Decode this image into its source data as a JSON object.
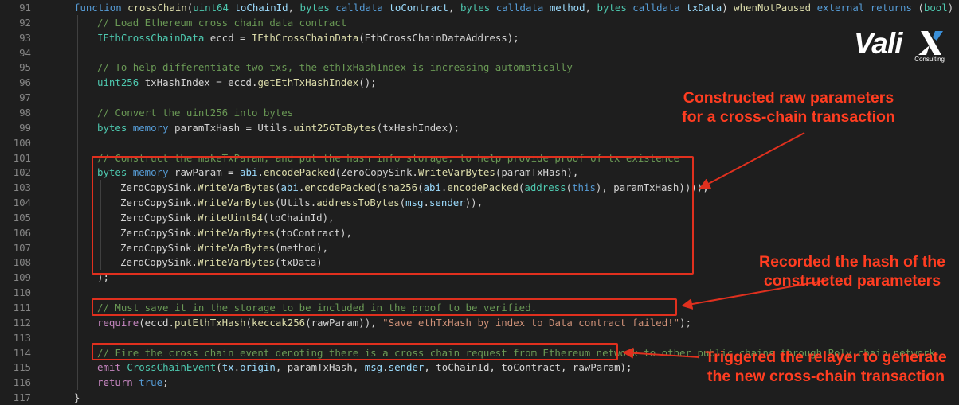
{
  "editor": {
    "lines": [
      {
        "n": "91",
        "indent": 1,
        "tokens": [
          [
            "kw",
            "function "
          ],
          [
            "fn",
            "crossChain"
          ],
          [
            "df",
            "("
          ],
          [
            "ty",
            "uint64 "
          ],
          [
            "pa",
            "toChainId"
          ],
          [
            "df",
            ", "
          ],
          [
            "ty",
            "bytes "
          ],
          [
            "kw",
            "calldata "
          ],
          [
            "pa",
            "toContract"
          ],
          [
            "df",
            ", "
          ],
          [
            "ty",
            "bytes "
          ],
          [
            "kw",
            "calldata "
          ],
          [
            "pa",
            "method"
          ],
          [
            "df",
            ", "
          ],
          [
            "ty",
            "bytes "
          ],
          [
            "kw",
            "calldata "
          ],
          [
            "pa",
            "txData"
          ],
          [
            "df",
            ") "
          ],
          [
            "fn",
            "whenNotPaused "
          ],
          [
            "kw",
            "external returns "
          ],
          [
            "df",
            "("
          ],
          [
            "ty",
            "bool"
          ],
          [
            "df",
            ") {"
          ]
        ]
      },
      {
        "n": "92",
        "indent": 2,
        "tokens": [
          [
            "cm",
            "// Load Ethereum cross chain data contract"
          ]
        ]
      },
      {
        "n": "93",
        "indent": 2,
        "tokens": [
          [
            "ty",
            "IEthCrossChainData "
          ],
          [
            "df",
            "eccd = "
          ],
          [
            "fn",
            "IEthCrossChainData"
          ],
          [
            "df",
            "(EthCrossChainDataAddress);"
          ]
        ]
      },
      {
        "n": "94",
        "indent": 2,
        "tokens": []
      },
      {
        "n": "95",
        "indent": 2,
        "tokens": [
          [
            "cm",
            "// To help differentiate two txs, the ethTxHashIndex is increasing automatically"
          ]
        ]
      },
      {
        "n": "96",
        "indent": 2,
        "tokens": [
          [
            "ty",
            "uint256 "
          ],
          [
            "df",
            "txHashIndex = eccd."
          ],
          [
            "fn",
            "getEthTxHashIndex"
          ],
          [
            "df",
            "();"
          ]
        ]
      },
      {
        "n": "97",
        "indent": 2,
        "tokens": []
      },
      {
        "n": "98",
        "indent": 2,
        "tokens": [
          [
            "cm",
            "// Convert the uint256 into bytes"
          ]
        ]
      },
      {
        "n": "99",
        "indent": 2,
        "tokens": [
          [
            "ty",
            "bytes "
          ],
          [
            "kw",
            "memory "
          ],
          [
            "df",
            "paramTxHash = Utils."
          ],
          [
            "fn",
            "uint256ToBytes"
          ],
          [
            "df",
            "(txHashIndex);"
          ]
        ]
      },
      {
        "n": "100",
        "indent": 2,
        "tokens": []
      },
      {
        "n": "101",
        "indent": 2,
        "tokens": [
          [
            "cm",
            "// Construct the makeTxParam, and put the hash info storage, to help provide proof of tx existence"
          ]
        ]
      },
      {
        "n": "102",
        "indent": 2,
        "tokens": [
          [
            "ty",
            "bytes "
          ],
          [
            "kw",
            "memory "
          ],
          [
            "df",
            "rawParam = "
          ],
          [
            "pa",
            "abi"
          ],
          [
            "df",
            "."
          ],
          [
            "fn",
            "encodePacked"
          ],
          [
            "df",
            "(ZeroCopySink."
          ],
          [
            "fn",
            "WriteVarBytes"
          ],
          [
            "df",
            "(paramTxHash),"
          ]
        ]
      },
      {
        "n": "103",
        "indent": 3,
        "tokens": [
          [
            "df",
            "ZeroCopySink."
          ],
          [
            "fn",
            "WriteVarBytes"
          ],
          [
            "df",
            "("
          ],
          [
            "pa",
            "abi"
          ],
          [
            "df",
            "."
          ],
          [
            "fn",
            "encodePacked"
          ],
          [
            "df",
            "("
          ],
          [
            "fn",
            "sha256"
          ],
          [
            "df",
            "("
          ],
          [
            "pa",
            "abi"
          ],
          [
            "df",
            "."
          ],
          [
            "fn",
            "encodePacked"
          ],
          [
            "df",
            "("
          ],
          [
            "ty",
            "address"
          ],
          [
            "df",
            "("
          ],
          [
            "kw",
            "this"
          ],
          [
            "df",
            "), paramTxHash)))),"
          ]
        ]
      },
      {
        "n": "104",
        "indent": 3,
        "tokens": [
          [
            "df",
            "ZeroCopySink."
          ],
          [
            "fn",
            "WriteVarBytes"
          ],
          [
            "df",
            "(Utils."
          ],
          [
            "fn",
            "addressToBytes"
          ],
          [
            "df",
            "("
          ],
          [
            "pa",
            "msg"
          ],
          [
            "df",
            "."
          ],
          [
            "pa",
            "sender"
          ],
          [
            "df",
            ")),"
          ]
        ]
      },
      {
        "n": "105",
        "indent": 3,
        "tokens": [
          [
            "df",
            "ZeroCopySink."
          ],
          [
            "fn",
            "WriteUint64"
          ],
          [
            "df",
            "(toChainId),"
          ]
        ]
      },
      {
        "n": "106",
        "indent": 3,
        "tokens": [
          [
            "df",
            "ZeroCopySink."
          ],
          [
            "fn",
            "WriteVarBytes"
          ],
          [
            "df",
            "(toContract),"
          ]
        ]
      },
      {
        "n": "107",
        "indent": 3,
        "tokens": [
          [
            "df",
            "ZeroCopySink."
          ],
          [
            "fn",
            "WriteVarBytes"
          ],
          [
            "df",
            "(method),"
          ]
        ]
      },
      {
        "n": "108",
        "indent": 3,
        "tokens": [
          [
            "df",
            "ZeroCopySink."
          ],
          [
            "fn",
            "WriteVarBytes"
          ],
          [
            "df",
            "(txData)"
          ]
        ]
      },
      {
        "n": "109",
        "indent": 2,
        "tokens": [
          [
            "df",
            ");"
          ]
        ]
      },
      {
        "n": "110",
        "indent": 2,
        "tokens": []
      },
      {
        "n": "111",
        "indent": 2,
        "tokens": [
          [
            "cm",
            "// Must save it in the storage to be included in the proof to be verified."
          ]
        ]
      },
      {
        "n": "112",
        "indent": 2,
        "tokens": [
          [
            "ct",
            "require"
          ],
          [
            "df",
            "(eccd."
          ],
          [
            "fn",
            "putEthTxHash"
          ],
          [
            "df",
            "("
          ],
          [
            "fn",
            "keccak256"
          ],
          [
            "df",
            "(rawParam)), "
          ],
          [
            "st",
            "\"Save ethTxHash by index to Data contract failed!\""
          ],
          [
            "df",
            ");"
          ]
        ]
      },
      {
        "n": "113",
        "indent": 2,
        "tokens": []
      },
      {
        "n": "114",
        "indent": 2,
        "tokens": [
          [
            "cm",
            "// Fire the cross chain event denoting there is a cross chain request from Ethereum network to other public chains through Poly chain network"
          ]
        ]
      },
      {
        "n": "115",
        "indent": 2,
        "tokens": [
          [
            "ct",
            "emit "
          ],
          [
            "ty",
            "CrossChainEvent"
          ],
          [
            "df",
            "("
          ],
          [
            "pa",
            "tx"
          ],
          [
            "df",
            "."
          ],
          [
            "pa",
            "origin"
          ],
          [
            "df",
            ", paramTxHash, "
          ],
          [
            "pa",
            "msg"
          ],
          [
            "df",
            "."
          ],
          [
            "pa",
            "sender"
          ],
          [
            "df",
            ", toChainId, toContract, rawParam);"
          ]
        ]
      },
      {
        "n": "116",
        "indent": 2,
        "tokens": [
          [
            "ct",
            "return "
          ],
          [
            "kw",
            "true"
          ],
          [
            "df",
            ";"
          ]
        ]
      },
      {
        "n": "117",
        "indent": 1,
        "tokens": [
          [
            "df",
            "}"
          ]
        ]
      }
    ]
  },
  "annotations": {
    "raw_params": [
      "Constructed raw parameters",
      "for a cross-chain transaction"
    ],
    "hash_recorded": [
      "Recorded the hash of the",
      "constructed parameters"
    ],
    "relayer": [
      "Triggered the relayer to generate",
      "the new cross-chain transaction"
    ]
  },
  "logo": {
    "word": "Vali",
    "tagline": "Consulting"
  },
  "colors": {
    "background": "#1e1e1e",
    "highlight": "#e0301e",
    "annotation": "#ff3d21"
  }
}
